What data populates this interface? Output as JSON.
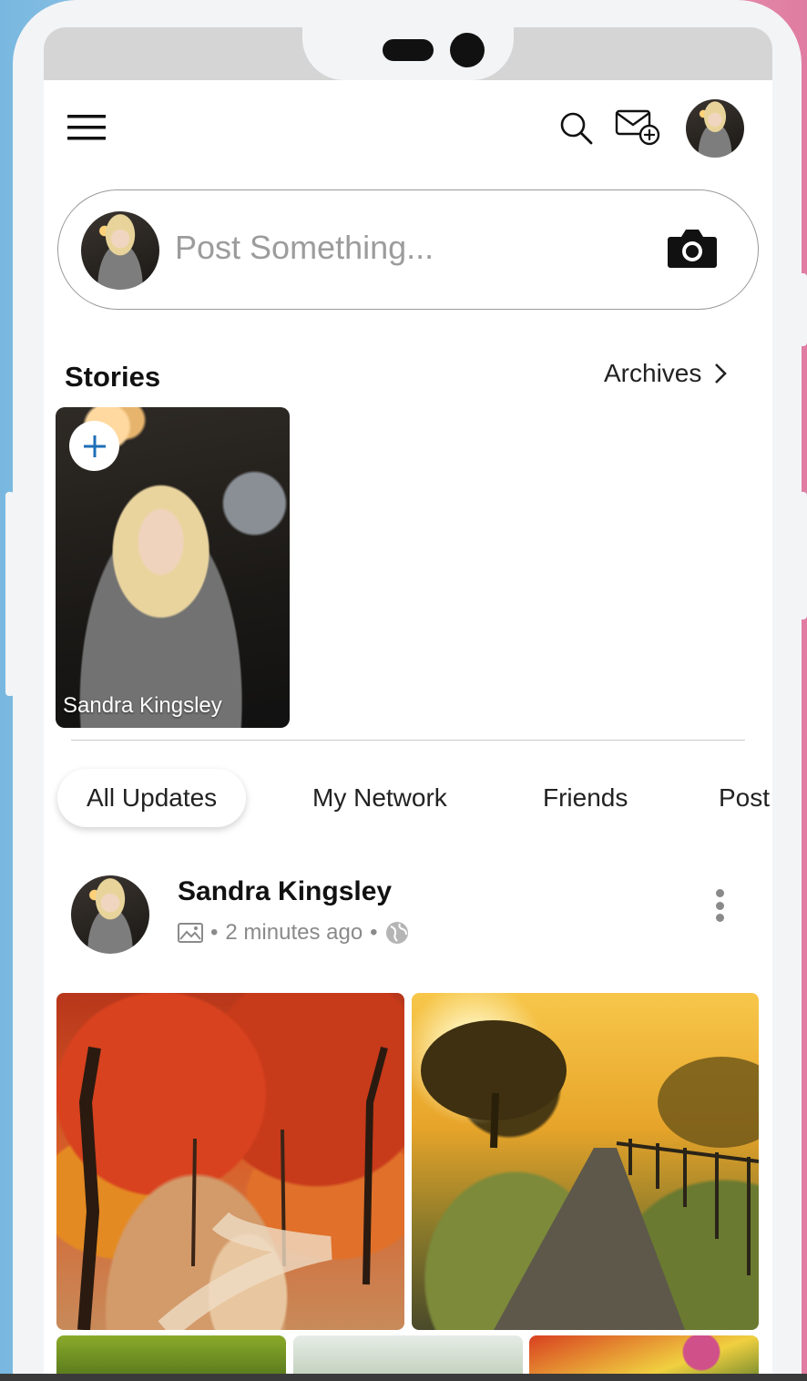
{
  "header": {
    "menu_icon": "hamburger-menu-icon",
    "search_icon": "search-icon",
    "compose_icon": "mail-plus-icon",
    "profile_icon": "avatar"
  },
  "composer": {
    "placeholder": "Post Something...",
    "camera_icon": "camera-icon"
  },
  "stories": {
    "title": "Stories",
    "archives_label": "Archives",
    "items": [
      {
        "name": "Sandra Kingsley",
        "add_icon": "plus-icon"
      }
    ]
  },
  "tabs": [
    {
      "label": "All Updates",
      "active": true
    },
    {
      "label": "My Network",
      "active": false
    },
    {
      "label": "Friends",
      "active": false
    },
    {
      "label": "Post",
      "active": false
    }
  ],
  "post": {
    "author": "Sandra Kingsley",
    "time": "2 minutes ago",
    "type_icon": "image-icon",
    "privacy_icon": "globe-icon",
    "menu_icon": "more-vertical-icon"
  },
  "colors": {
    "accent": "#1e6fb8",
    "text": "#111111",
    "muted": "#8a8a8a"
  }
}
